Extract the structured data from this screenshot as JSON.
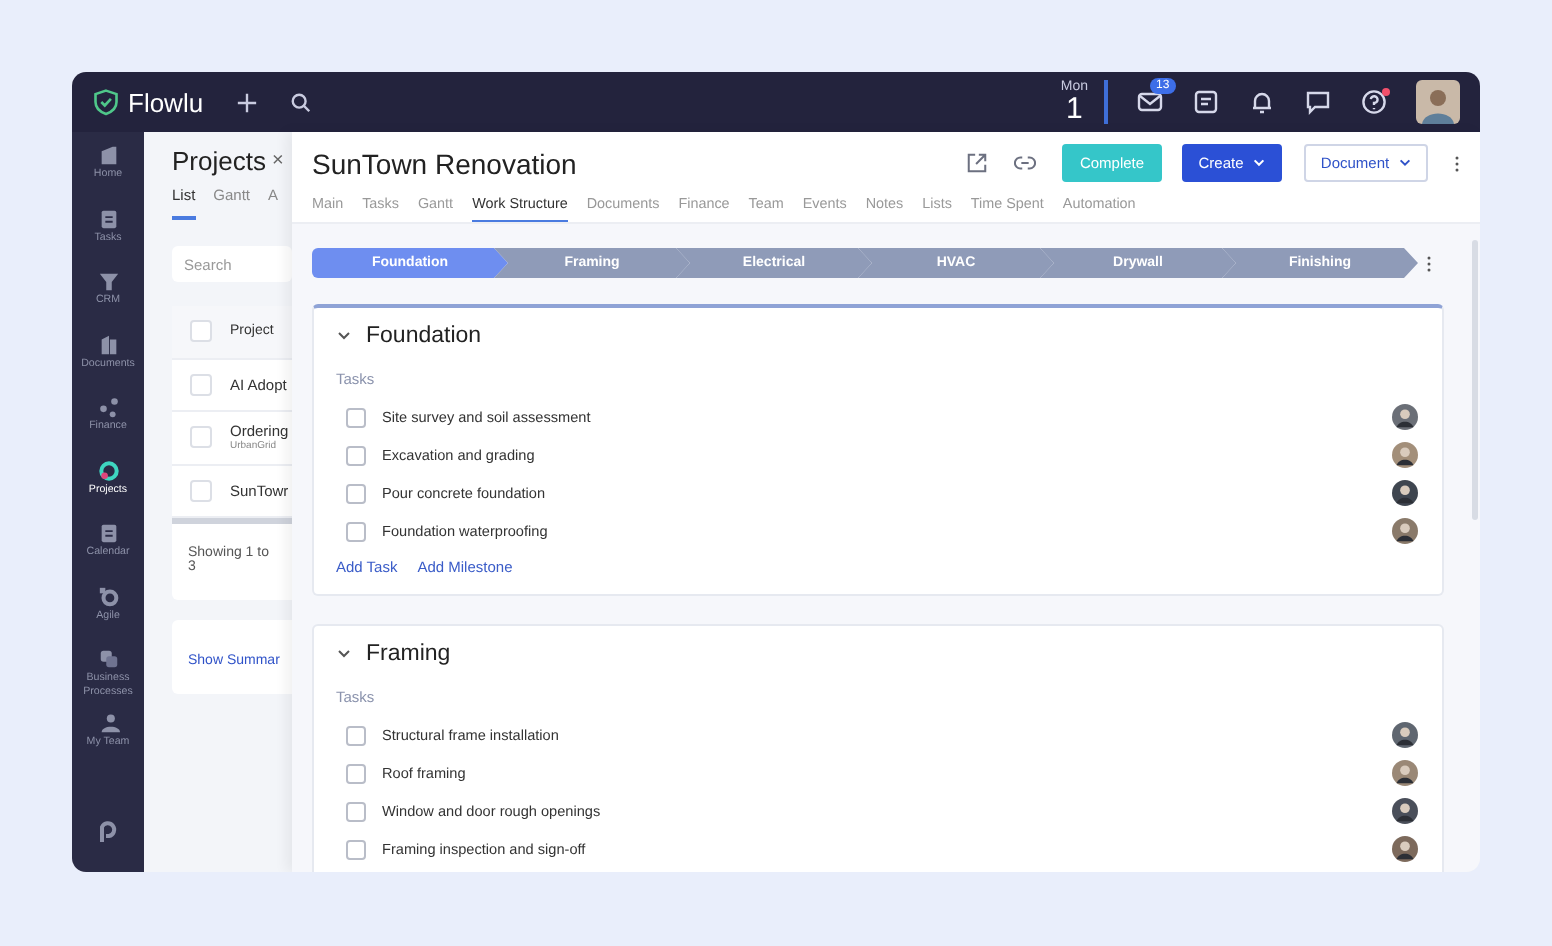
{
  "topbar": {
    "logo": "Flowlu",
    "weekday": "Mon",
    "day": "1",
    "mail_badge": "13",
    "help_alert": true
  },
  "sidebar": {
    "items": [
      {
        "label": "Home",
        "selected": false
      },
      {
        "label": "Tasks",
        "selected": false
      },
      {
        "label": "CRM",
        "selected": false
      },
      {
        "label": "Documents",
        "selected": false
      },
      {
        "label": "Finance",
        "selected": false
      },
      {
        "label": "Projects",
        "selected": true
      },
      {
        "label": "Calendar",
        "selected": false
      },
      {
        "label": "Agile",
        "selected": false
      },
      {
        "label": "Business Processes",
        "selected": false
      },
      {
        "label": "My Team",
        "selected": false
      }
    ]
  },
  "projects_panel": {
    "title": "Projects",
    "close": "×",
    "tabs": [
      {
        "label": "List",
        "selected": true
      },
      {
        "label": "Gantt",
        "selected": false
      },
      {
        "label": "A",
        "selected": false
      }
    ],
    "search": {
      "placeholder": "Search"
    },
    "column": "Project",
    "all_checked": false,
    "rows": [
      {
        "name": "AI Adopt",
        "checked": false
      },
      {
        "name": "Ordering",
        "subtitle": "UrbanGrid",
        "checked": false
      },
      {
        "name": "SunTowr",
        "checked": false
      }
    ],
    "footer": "Showing 1 to 3",
    "summary_link": "Show Summar"
  },
  "project": {
    "title": "SunTown Renovation",
    "buttons": {
      "complete": "Complete",
      "create": "Create",
      "document": "Document"
    },
    "tabs": [
      {
        "label": "Main",
        "selected": false
      },
      {
        "label": "Tasks",
        "selected": false
      },
      {
        "label": "Gantt",
        "selected": false
      },
      {
        "label": "Work Structure",
        "selected": true
      },
      {
        "label": "Documents",
        "selected": false
      },
      {
        "label": "Finance",
        "selected": false
      },
      {
        "label": "Team",
        "selected": false
      },
      {
        "label": "Events",
        "selected": false
      },
      {
        "label": "Notes",
        "selected": false
      },
      {
        "label": "Lists",
        "selected": false
      },
      {
        "label": "Time Spent",
        "selected": false
      },
      {
        "label": "Automation",
        "selected": false
      }
    ],
    "stages": [
      {
        "label": "Foundation",
        "selected": true
      },
      {
        "label": "Framing",
        "selected": false
      },
      {
        "label": "Electrical",
        "selected": false
      },
      {
        "label": "HVAC",
        "selected": false
      },
      {
        "label": "Drywall",
        "selected": false
      },
      {
        "label": "Finishing",
        "selected": false
      }
    ],
    "sections": [
      {
        "title": "Foundation",
        "expanded": true,
        "tasks_label": "Tasks",
        "tasks": [
          {
            "name": "Site survey and soil assessment",
            "checked": false
          },
          {
            "name": "Excavation and grading",
            "checked": false
          },
          {
            "name": "Pour concrete foundation",
            "checked": false
          },
          {
            "name": "Foundation waterproofing",
            "checked": false
          }
        ],
        "links": [
          "Add Task",
          "Add Milestone"
        ]
      },
      {
        "title": "Framing",
        "expanded": true,
        "tasks_label": "Tasks",
        "tasks": [
          {
            "name": "Structural frame installation",
            "checked": false
          },
          {
            "name": "Roof framing",
            "checked": false
          },
          {
            "name": "Window and door rough openings",
            "checked": false
          },
          {
            "name": "Framing inspection and sign-off",
            "checked": false
          }
        ]
      }
    ]
  }
}
